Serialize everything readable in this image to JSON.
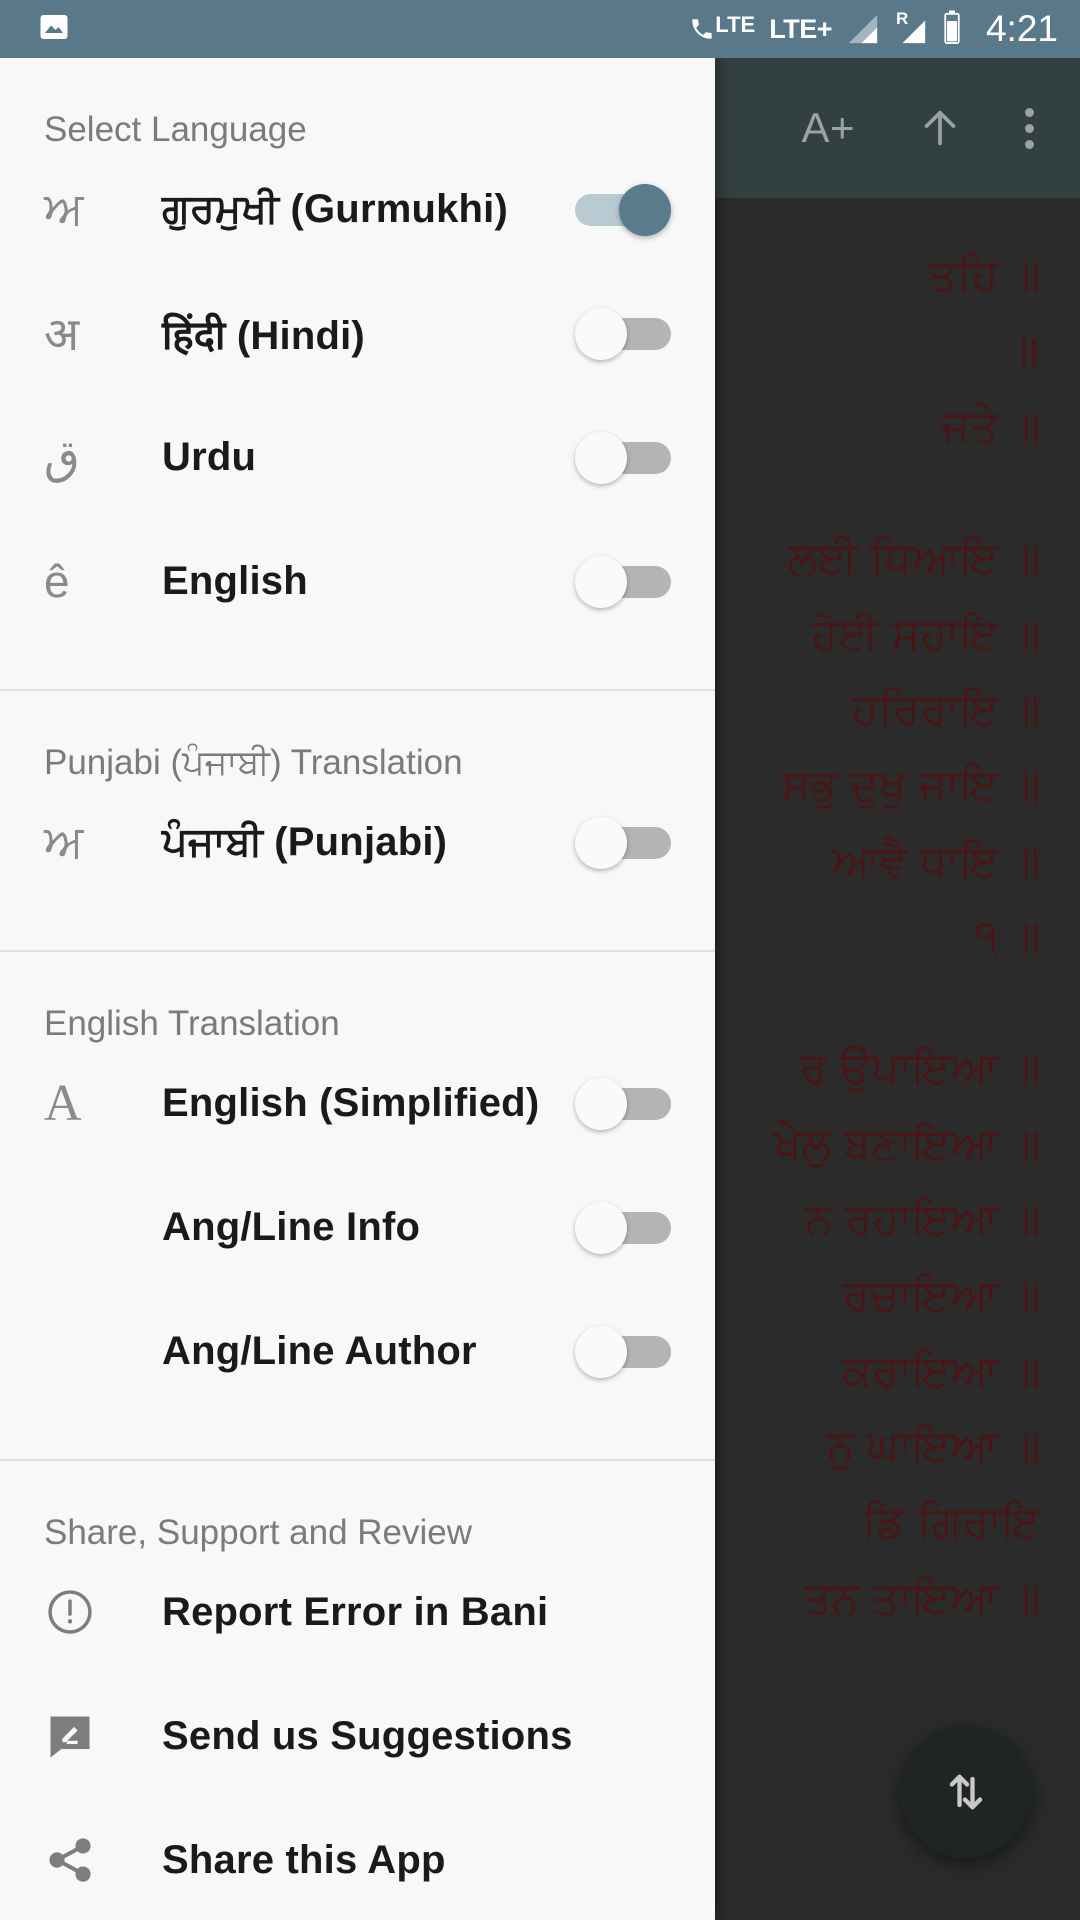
{
  "statusbar": {
    "photo_icon": "image-icon",
    "call_lte_label": "LTE",
    "network_label": "LTE+",
    "roaming_label": "R",
    "time": "4:21"
  },
  "background": {
    "toolbar": {
      "font_increase_label": "A+",
      "scroll_up_icon": "arrow-up-icon",
      "overflow_icon": "more-vertical-icon"
    },
    "fab_icon": "swap-vertical-icon",
    "text_lines": [
      "ਤਹਿ ॥",
      "॥",
      "ਜਤੇ ॥",
      "",
      "ਲਈ ਧਿਆਇ ॥",
      "ਹੋਈ ਸਹਾਇ ॥",
      "ਹਰਿਰਾਇ ॥",
      "ਸਭੁ ਦੁਖੁ ਜਾਇ ॥",
      "ਆਵੈ ਧਾਇ ॥",
      "੧ ॥",
      "",
      "ਰ ਉਪਾਇਆ ॥",
      "ਖੇਲੁ ਬਣਾਇਆ ॥",
      "ਨ ਰਹਾਇਆ ॥",
      "ਰਚਾਇਆ ॥",
      "ਕਰਾਇਆ ॥",
      "ਨੁ ਘਾਇਆ ॥",
      "ਡਿ ਗਿਰਾਇ",
      "ਤਨ ਤਾਇਆ ॥"
    ]
  },
  "drawer": {
    "sections": [
      {
        "title": "Select Language",
        "items": [
          {
            "icon_glyph": "ਅ",
            "icon_name": "gurmukhi-letter-icon",
            "label": "ਗੁਰਮੁਖੀ (Gurmukhi)",
            "toggle": "on"
          },
          {
            "icon_glyph": "अ",
            "icon_name": "devanagari-letter-icon",
            "label": "हिंदी (Hindi)",
            "toggle": "off"
          },
          {
            "icon_glyph": "ق",
            "icon_name": "arabic-letter-icon",
            "label": "Urdu",
            "toggle": "off"
          },
          {
            "icon_glyph": "ê",
            "icon_name": "latin-letter-icon",
            "label": "English",
            "toggle": "off"
          }
        ]
      },
      {
        "title": "Punjabi (ਪੰਜਾਬੀ) Translation",
        "items": [
          {
            "icon_glyph": "ਅ",
            "icon_name": "gurmukhi-letter-icon",
            "label": "ਪੰਜਾਬੀ (Punjabi)",
            "toggle": "off"
          }
        ]
      },
      {
        "title": "English Translation",
        "items": [
          {
            "icon_glyph": "A",
            "icon_name": "latin-capital-a-icon",
            "label": "English (Simplified)",
            "toggle": "off"
          },
          {
            "icon_glyph": "",
            "icon_name": "",
            "label": "Ang/Line Info",
            "toggle": "off"
          },
          {
            "icon_glyph": "",
            "icon_name": "",
            "label": "Ang/Line Author",
            "toggle": "off"
          }
        ]
      },
      {
        "title": "Share, Support and Review",
        "items": [
          {
            "icon_glyph": "",
            "icon_name": "error-circle-icon",
            "label": "Report Error in Bani",
            "toggle": null
          },
          {
            "icon_glyph": "",
            "icon_name": "feedback-icon",
            "label": "Send us Suggestions",
            "toggle": null
          },
          {
            "icon_glyph": "",
            "icon_name": "share-icon",
            "label": "Share this App",
            "toggle": null
          }
        ]
      }
    ]
  }
}
